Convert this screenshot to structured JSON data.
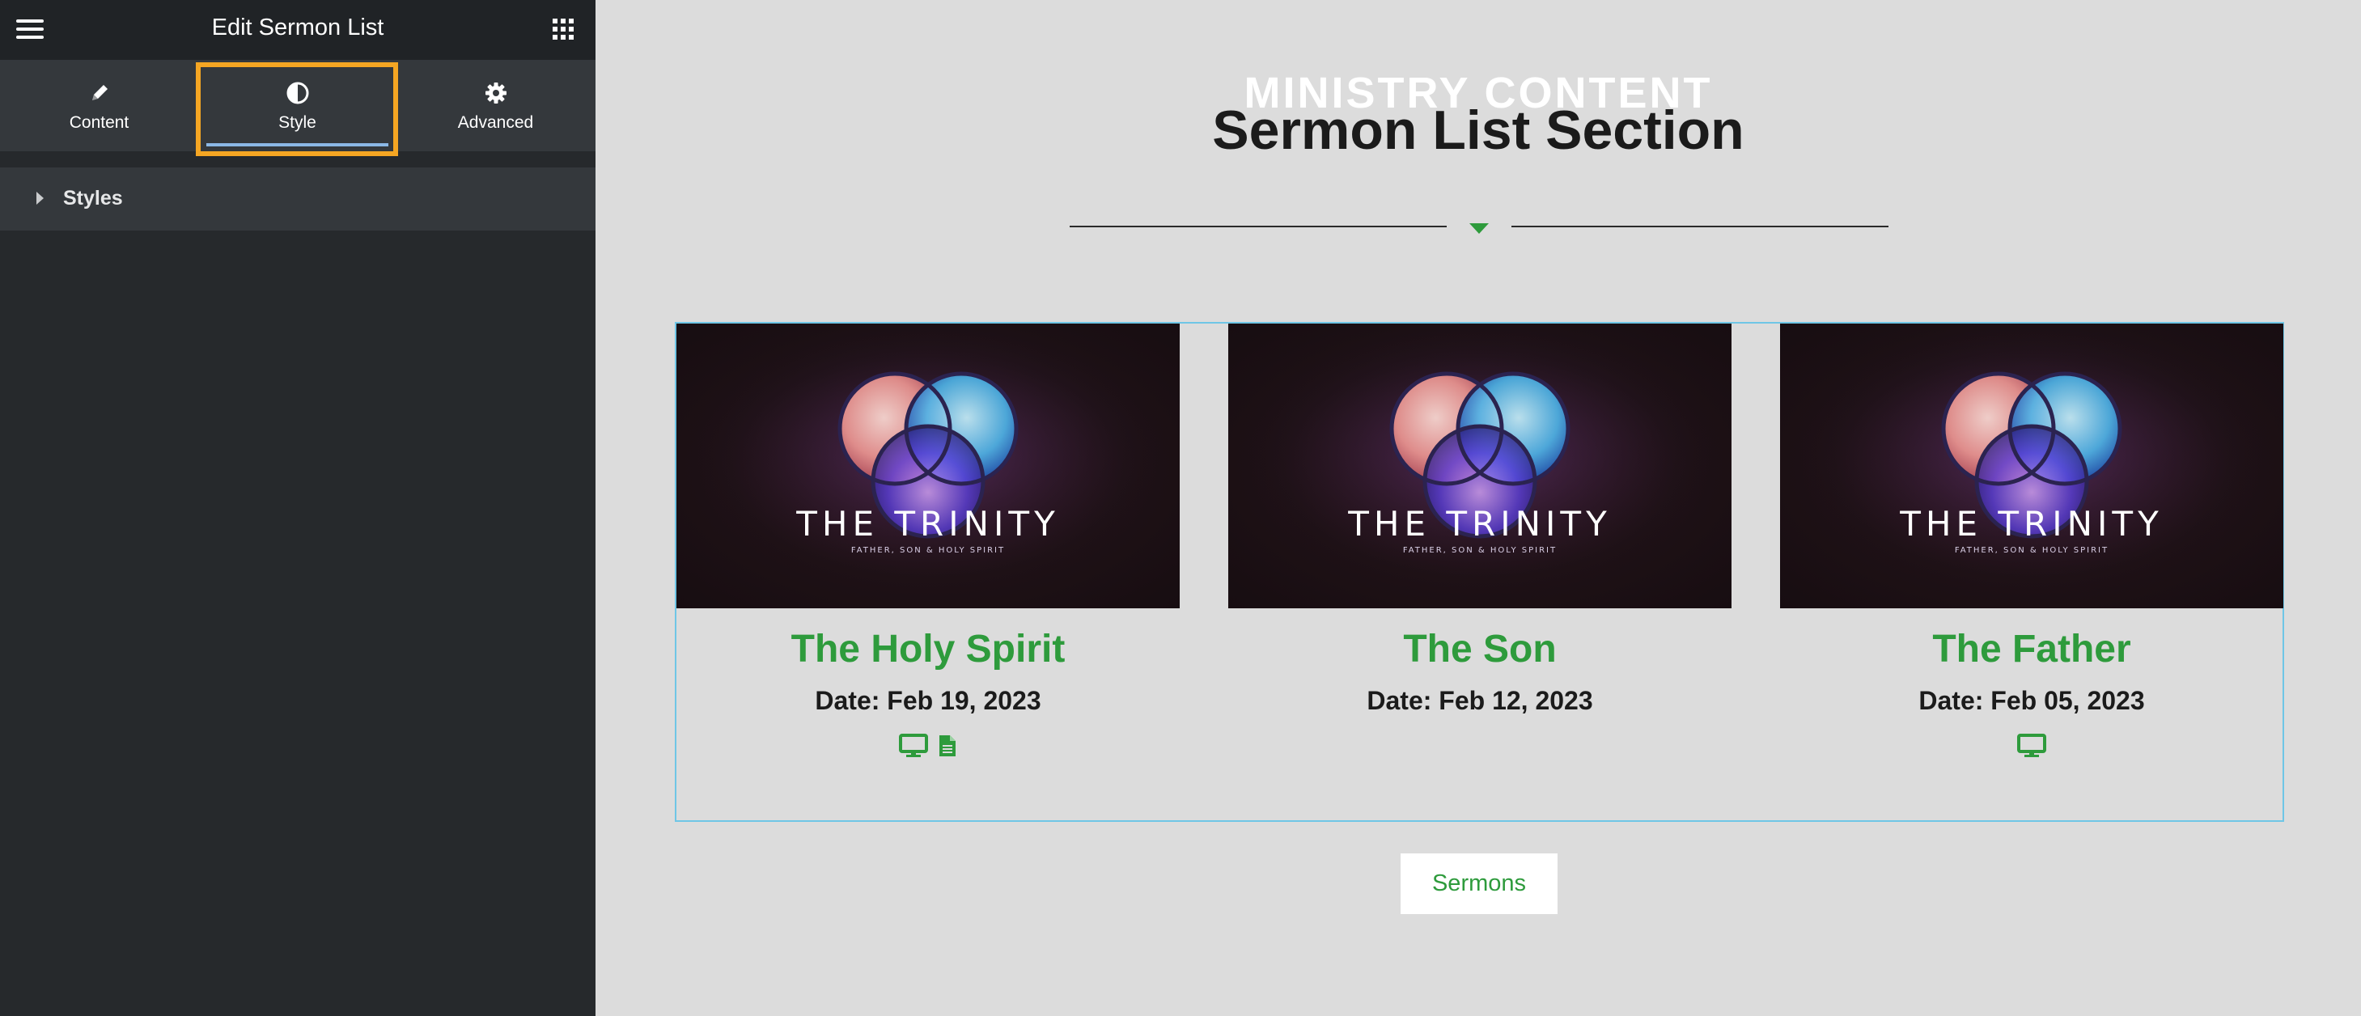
{
  "panel": {
    "title": "Edit Sermon List",
    "menu_icon": "hamburger-menu-icon",
    "apps_icon": "apps-grid-icon",
    "tabs": [
      {
        "label": "Content",
        "icon": "pencil-icon",
        "active": false
      },
      {
        "label": "Style",
        "icon": "half-circle-contrast-icon",
        "active": true
      },
      {
        "label": "Advanced",
        "icon": "gear-icon",
        "active": false
      }
    ],
    "sections": [
      {
        "label": "Styles",
        "icon": "caret-right-icon",
        "expanded": false
      }
    ]
  },
  "preview": {
    "eyebrow": "MINISTRY CONTENT",
    "title": "Sermon List Section",
    "sermons": [
      {
        "title": "The Holy Spirit",
        "date": "Date: Feb 19, 2023",
        "image_text": "THE TRINITY",
        "image_subtext": "FATHER, SON & HOLY SPIRIT",
        "media": [
          "video-monitor-icon",
          "document-icon"
        ]
      },
      {
        "title": "The Son",
        "date": "Date: Feb 12, 2023",
        "image_text": "THE TRINITY",
        "image_subtext": "FATHER, SON & HOLY SPIRIT",
        "media": []
      },
      {
        "title": "The Father",
        "date": "Date: Feb 05, 2023",
        "image_text": "THE TRINITY",
        "image_subtext": "FATHER, SON & HOLY SPIRIT",
        "media": [
          "video-monitor-icon"
        ]
      }
    ],
    "button_label": "Sermons"
  },
  "colors": {
    "accent_green": "#2e9b3c",
    "panel_dark": "#26292c",
    "highlight_orange": "#f5a623",
    "selection_blue": "#6fc6e6",
    "preview_bg": "#dcdcdc"
  }
}
